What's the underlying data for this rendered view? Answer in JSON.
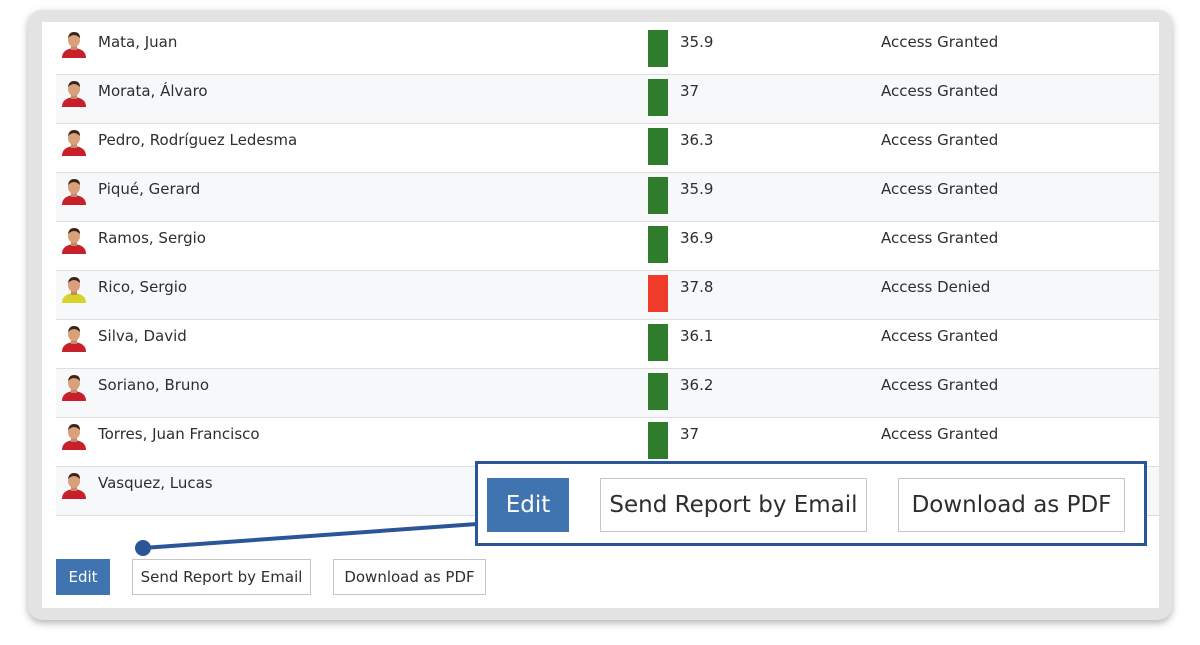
{
  "rows": [
    {
      "name": "Mata, Juan",
      "temperature": "35.9",
      "status_color": "#2f7d2c",
      "access": "Access Granted",
      "avatar_kit": "#c8202a"
    },
    {
      "name": "Morata, Álvaro",
      "temperature": "37",
      "status_color": "#2f7d2c",
      "access": "Access Granted",
      "avatar_kit": "#c8202a"
    },
    {
      "name": "Pedro, Rodríguez Ledesma",
      "temperature": "36.3",
      "status_color": "#2f7d2c",
      "access": "Access Granted",
      "avatar_kit": "#c8202a"
    },
    {
      "name": "Piqué, Gerard",
      "temperature": "35.9",
      "status_color": "#2f7d2c",
      "access": "Access Granted",
      "avatar_kit": "#c8202a"
    },
    {
      "name": "Ramos, Sergio",
      "temperature": "36.9",
      "status_color": "#2f7d2c",
      "access": "Access Granted",
      "avatar_kit": "#c8202a"
    },
    {
      "name": "Rico, Sergio",
      "temperature": "37.8",
      "status_color": "#ef3b2a",
      "access": "Access Denied",
      "avatar_kit": "#d8d22a"
    },
    {
      "name": "Silva, David",
      "temperature": "36.1",
      "status_color": "#2f7d2c",
      "access": "Access Granted",
      "avatar_kit": "#c8202a"
    },
    {
      "name": "Soriano, Bruno",
      "temperature": "36.2",
      "status_color": "#2f7d2c",
      "access": "Access Granted",
      "avatar_kit": "#c8202a"
    },
    {
      "name": "Torres, Juan Francisco",
      "temperature": "37",
      "status_color": "#2f7d2c",
      "access": "Access Granted",
      "avatar_kit": "#c8202a"
    },
    {
      "name": "Vasquez, Lucas",
      "temperature": "",
      "status_color": "",
      "access": "",
      "avatar_kit": "#c8202a"
    }
  ],
  "actions": {
    "edit_label": "Edit",
    "email_label": "Send Report by Email",
    "pdf_label": "Download as PDF"
  },
  "colors": {
    "primary": "#3f74b0",
    "callout_border": "#2a5596",
    "granted": "#2f7d2c",
    "denied": "#ef3b2a"
  }
}
